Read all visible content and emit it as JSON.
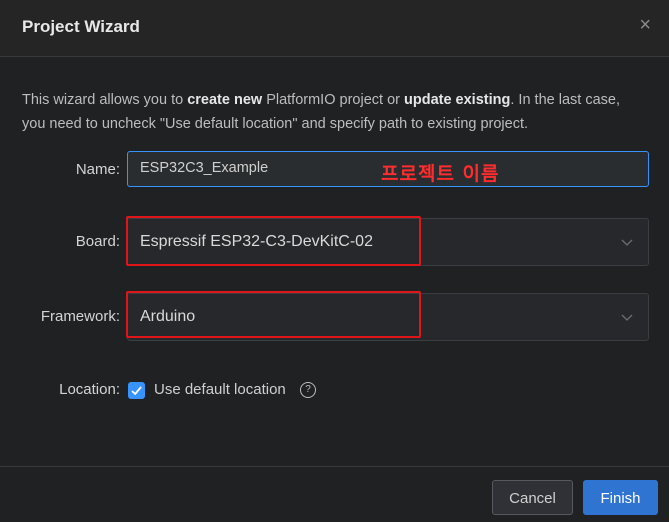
{
  "dialog": {
    "title": "Project Wizard",
    "close_glyph": "×"
  },
  "intro": {
    "part1": "This wizard allows you to ",
    "bold1": "create new",
    "part2": " PlatformIO project or ",
    "bold2": "update existing",
    "part3": ". In the last case, you need to uncheck \"Use default location\" and specify path to existing project."
  },
  "form": {
    "name_label": "Name:",
    "name_value": "ESP32C3_Example",
    "name_annotation": "프로젝트 이름",
    "board_label": "Board:",
    "board_value": "Espressif ESP32-C3-DevKitC-02",
    "framework_label": "Framework:",
    "framework_value": "Arduino",
    "location_label": "Location:",
    "location_checkbox_label": "Use default location",
    "location_checked": true,
    "help_glyph": "?"
  },
  "footer": {
    "cancel_label": "Cancel",
    "finish_label": "Finish"
  },
  "colors": {
    "accent": "#3794ff",
    "annotation_red": "#e0151a",
    "primary_button": "#2f74d0"
  },
  "icons": [
    "close-icon",
    "chevron-down-icon",
    "checkmark-icon",
    "help-icon"
  ]
}
